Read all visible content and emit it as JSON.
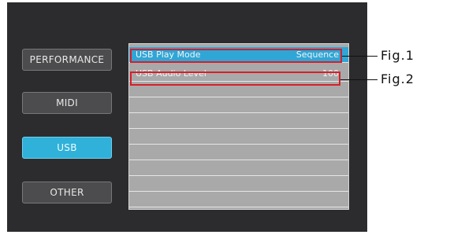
{
  "sidebar": {
    "items": [
      {
        "label": "PERFORMANCE",
        "active": false
      },
      {
        "label": "MIDI",
        "active": false
      },
      {
        "label": "USB",
        "active": true
      },
      {
        "label": "OTHER",
        "active": false
      }
    ]
  },
  "settings": {
    "rows": [
      {
        "label": "USB Play Mode",
        "value": "Sequence",
        "selected": true
      },
      {
        "label": "USB Audio Level",
        "value": "100",
        "selected": false
      },
      {
        "label": "",
        "value": ""
      },
      {
        "label": "",
        "value": ""
      },
      {
        "label": "",
        "value": ""
      },
      {
        "label": "",
        "value": ""
      },
      {
        "label": "",
        "value": ""
      },
      {
        "label": "",
        "value": ""
      },
      {
        "label": "",
        "value": ""
      },
      {
        "label": "",
        "value": ""
      }
    ]
  },
  "callouts": [
    {
      "label": "Fig.1"
    },
    {
      "label": "Fig.2"
    }
  ],
  "colors": {
    "accent": "#2fb1d9",
    "highlight_box": "#d61f2b",
    "screen_bg": "#2c2c2e",
    "list_bg": "#a9a9a9"
  }
}
